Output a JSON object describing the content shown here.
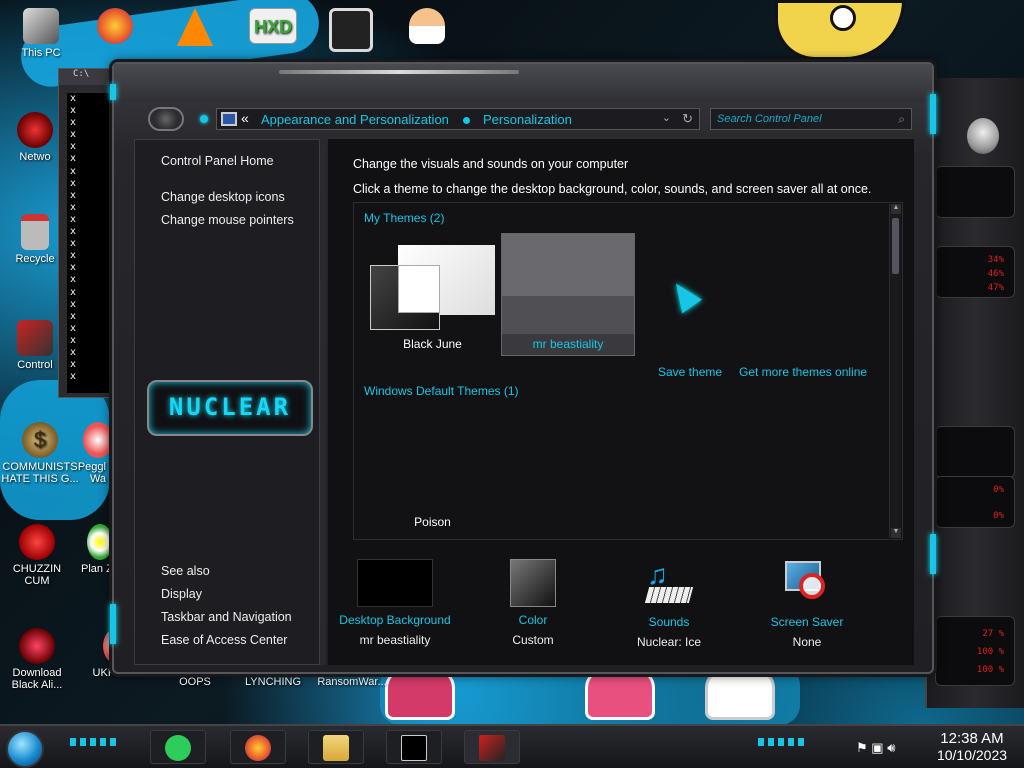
{
  "desktop": {
    "icons": [
      {
        "label": "This PC"
      },
      {
        "label": "Netwo"
      },
      {
        "label": "Recycle"
      },
      {
        "label": "Control"
      },
      {
        "label": "COMMUNISTS HATE THIS G..."
      },
      {
        "label": "Peggl of Wa"
      },
      {
        "label": "CHUZZIN CUM"
      },
      {
        "label": "Plan Zo"
      },
      {
        "label": "Download Black Ali..."
      },
      {
        "label": "UKRAINE"
      },
      {
        "label": "OOPS"
      },
      {
        "label": "LYNCHING"
      },
      {
        "label": "RansomWar..."
      }
    ],
    "widget_percents": [
      "34%",
      "46%",
      "47%",
      "0%",
      "0%",
      "27 %",
      "100 %",
      "100 %"
    ]
  },
  "cmd_window": {
    "title": "C:\\",
    "lines": [
      "x",
      "x",
      "x",
      "x",
      "x",
      "x",
      "x",
      "x",
      "x",
      "x",
      "x",
      "x",
      "x",
      "x",
      "x",
      "x",
      "x",
      "x",
      "x",
      "x",
      "x",
      "x",
      "x",
      "x"
    ]
  },
  "window": {
    "breadcrumb": [
      "Appearance and Personalization",
      "Personalization"
    ],
    "back_chevron": "«",
    "search_placeholder": "Search Control Panel",
    "left_nav": {
      "home": "Control Panel Home",
      "links": [
        "Change desktop icons",
        "Change mouse pointers"
      ],
      "logo_text": "NUCLEAR",
      "see_also_title": "See also",
      "see_also": [
        "Display",
        "Taskbar and Navigation",
        "Ease of Access Center"
      ]
    },
    "content": {
      "title": "Change the visuals and sounds on your computer",
      "subtitle": "Click a theme to change the desktop background, color, sounds, and screen saver all at once.",
      "my_themes_header": "My Themes (2)",
      "my_themes": [
        {
          "name": "Black June",
          "selected": false
        },
        {
          "name": "mr beastiality",
          "selected": true
        }
      ],
      "save_theme": "Save theme",
      "get_more": "Get more themes online",
      "default_header": "Windows Default Themes (1)",
      "default_themes": [
        {
          "name": "Poison"
        }
      ]
    },
    "bottom": [
      {
        "title": "Desktop Background",
        "value": "mr beastiality",
        "icon": "black-swatch-icon"
      },
      {
        "title": "Color",
        "value": "Custom",
        "icon": "gray-swatch-icon"
      },
      {
        "title": "Sounds",
        "value": "Nuclear: Ice",
        "icon": "music-notes-icon"
      },
      {
        "title": "Screen Saver",
        "value": "None",
        "icon": "no-screensaver-icon"
      }
    ]
  },
  "taskbar": {
    "clock_time": "12:38 AM",
    "clock_date": "10/10/2023",
    "apps": [
      "spotify-icon",
      "firefox-icon",
      "file-explorer-icon",
      "cmd-icon",
      "nuclear-theme-icon"
    ]
  },
  "colors": {
    "accent": "#17c6e6",
    "window_bg": "#202024",
    "content_bg": "#111113"
  }
}
